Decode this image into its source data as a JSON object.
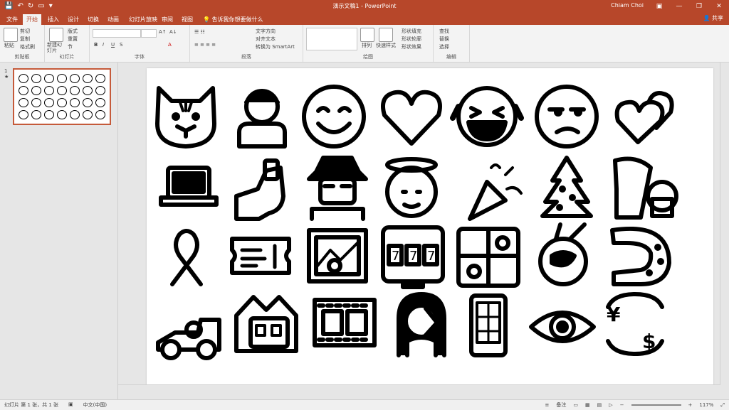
{
  "app": {
    "title": "演示文稿1 - PowerPoint",
    "user": "Chiam Choi",
    "share_label": "共享",
    "search_hint": "告诉我你想要做什么"
  },
  "tabs": [
    {
      "label": "文件"
    },
    {
      "label": "开始"
    },
    {
      "label": "插入"
    },
    {
      "label": "设计"
    },
    {
      "label": "切换"
    },
    {
      "label": "动画"
    },
    {
      "label": "幻灯片放映"
    },
    {
      "label": "审阅"
    },
    {
      "label": "视图"
    }
  ],
  "ribbon": {
    "clipboard": {
      "paste": "粘贴",
      "cut": "剪切",
      "copy": "复制",
      "format_painter": "格式刷",
      "label": "剪贴板"
    },
    "slides": {
      "new_slide": "新建幻灯片",
      "layout": "版式",
      "reset": "重置",
      "section": "节",
      "label": "幻灯片"
    },
    "font": {
      "bold": "B",
      "italic": "I",
      "underline": "U",
      "strike": "S",
      "label": "字体"
    },
    "paragraph": {
      "text_direction": "文字方向",
      "align_text": "对齐文本",
      "smartart": "转换为 SmartArt",
      "label": "段落"
    },
    "drawing": {
      "arrange": "排列",
      "quick_styles": "快速样式",
      "fill": "形状填充",
      "outline": "形状轮廓",
      "effects": "形状效果",
      "label": "绘图"
    },
    "editing": {
      "find": "查找",
      "replace": "替换",
      "select": "选择",
      "label": "编辑"
    }
  },
  "side": {
    "slide_number": "1",
    "star": "★"
  },
  "status": {
    "slide_info": "幻灯片 第 1 张，共 1 张",
    "language": "中文(中国)",
    "notes": "备注",
    "zoom": "117%"
  },
  "icons": [
    [
      "cat-face-icon",
      "person-icon",
      "smiling-face-icon",
      "heart-icon",
      "laughing-tears-face-icon",
      "unamused-face-icon",
      "two-hearts-icon"
    ],
    [
      "laptop-icon",
      "selfie-icon",
      "spy-icon",
      "angel-icon",
      "party-popper-icon",
      "christmas-tree-icon",
      "wind-chime-icon"
    ],
    [
      "ribbon-icon",
      "ticket-icon",
      "framed-picture-icon",
      "slot-machine-icon",
      "bento-box-icon",
      "steaming-bowl-icon",
      "fish-cake-icon"
    ],
    [
      "race-car-icon",
      "mountain-railway-icon",
      "film-strip-icon",
      "facepalm-woman-icon",
      "mobile-phone-icon",
      "eye-icon",
      "currency-exchange-icon"
    ]
  ]
}
